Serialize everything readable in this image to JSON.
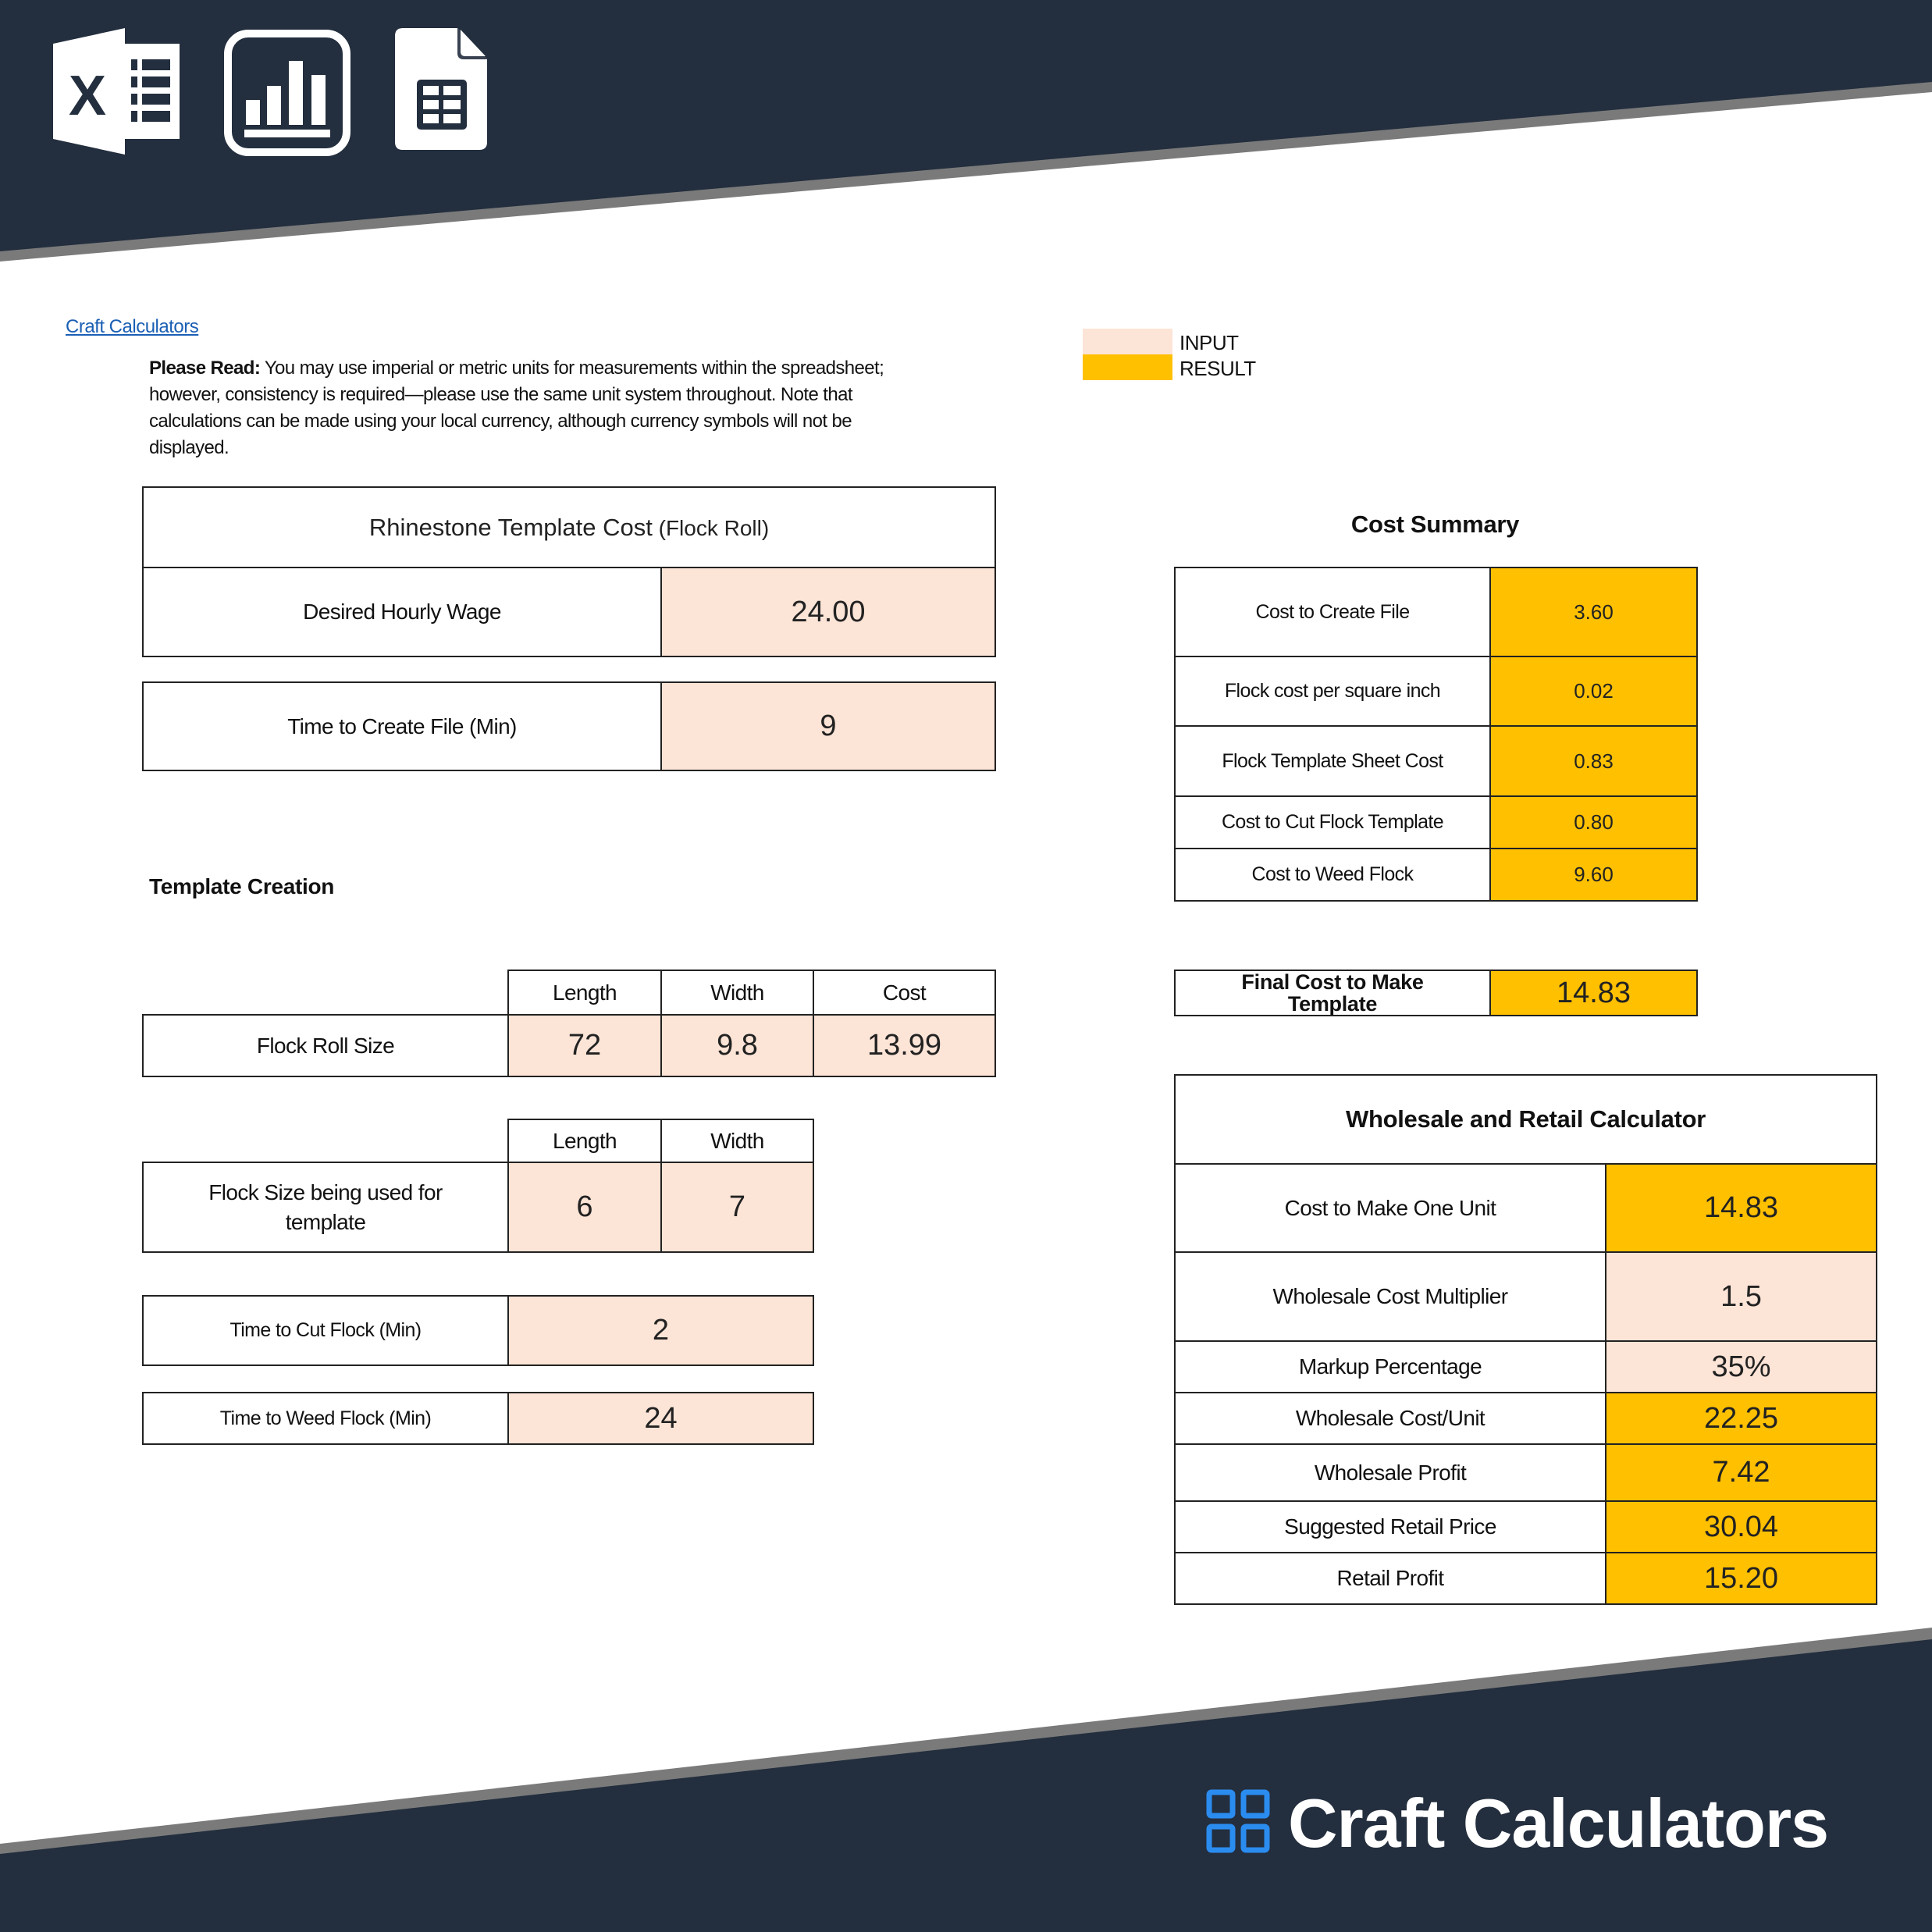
{
  "header": {
    "icons": [
      "excel-icon",
      "bar-chart-icon",
      "sheets-document-icon"
    ]
  },
  "link": {
    "label": "Craft Calculators"
  },
  "note": {
    "bold_prefix": "Please Read:",
    "text": " You may use imperial or metric units for measurements within the spreadsheet; however, consistency is required—please use the same unit system throughout. Note that calculations can be made using your local currency, although currency symbols will not be displayed."
  },
  "legend": {
    "input_label": "INPUT",
    "result_label": "RESULT",
    "input_color": "#fce4d6",
    "result_color": "#ffc000"
  },
  "template_cost": {
    "title": "Rhinestone Template Cost",
    "title_suffix": " (Flock Roll)",
    "hourly_wage_label": "Desired Hourly Wage",
    "hourly_wage_value": "24.00",
    "time_create_label": "Time to Create File (Min)",
    "time_create_value": "9"
  },
  "template_creation": {
    "heading": "Template Creation",
    "roll": {
      "headers": [
        "Length",
        "Width",
        "Cost"
      ],
      "label": "Flock Roll Size",
      "values": [
        "72",
        "9.8",
        "13.99"
      ]
    },
    "used": {
      "headers": [
        "Length",
        "Width"
      ],
      "label": "Flock Size being used for template",
      "values": [
        "6",
        "7"
      ]
    },
    "cut_label": "Time to Cut Flock (Min)",
    "cut_value": "2",
    "weed_label": "Time to Weed Flock (Min)",
    "weed_value": "24"
  },
  "cost_summary": {
    "heading": "Cost Summary",
    "rows": [
      {
        "label": "Cost to Create File",
        "value": "3.60"
      },
      {
        "label": "Flock cost per square inch",
        "value": "0.02"
      },
      {
        "label": "Flock Template Sheet Cost",
        "value": "0.83"
      },
      {
        "label": "Cost to Cut Flock Template",
        "value": "0.80"
      },
      {
        "label": "Cost to Weed Flock",
        "value": "9.60"
      }
    ],
    "final_label": "Final Cost to Make Template",
    "final_value": "14.83"
  },
  "wholesale": {
    "title": "Wholesale and Retail Calculator",
    "rows": [
      {
        "label": "Cost to Make One Unit",
        "value": "14.83",
        "kind": "result"
      },
      {
        "label": "Wholesale Cost Multiplier",
        "value": "1.5",
        "kind": "input"
      },
      {
        "label": "Markup Percentage",
        "value": "35%",
        "kind": "input"
      },
      {
        "label": "Wholesale Cost/Unit",
        "value": "22.25",
        "kind": "result"
      },
      {
        "label": "Wholesale Profit",
        "value": "7.42",
        "kind": "result"
      },
      {
        "label": "Suggested Retail Price",
        "value": "30.04",
        "kind": "result"
      },
      {
        "label": "Retail Profit",
        "value": "15.20",
        "kind": "result"
      }
    ]
  },
  "footer": {
    "brand": "Craft Calculators",
    "brand_icon_color": "#2b8cf0",
    "banner_color": "#232e3e"
  }
}
